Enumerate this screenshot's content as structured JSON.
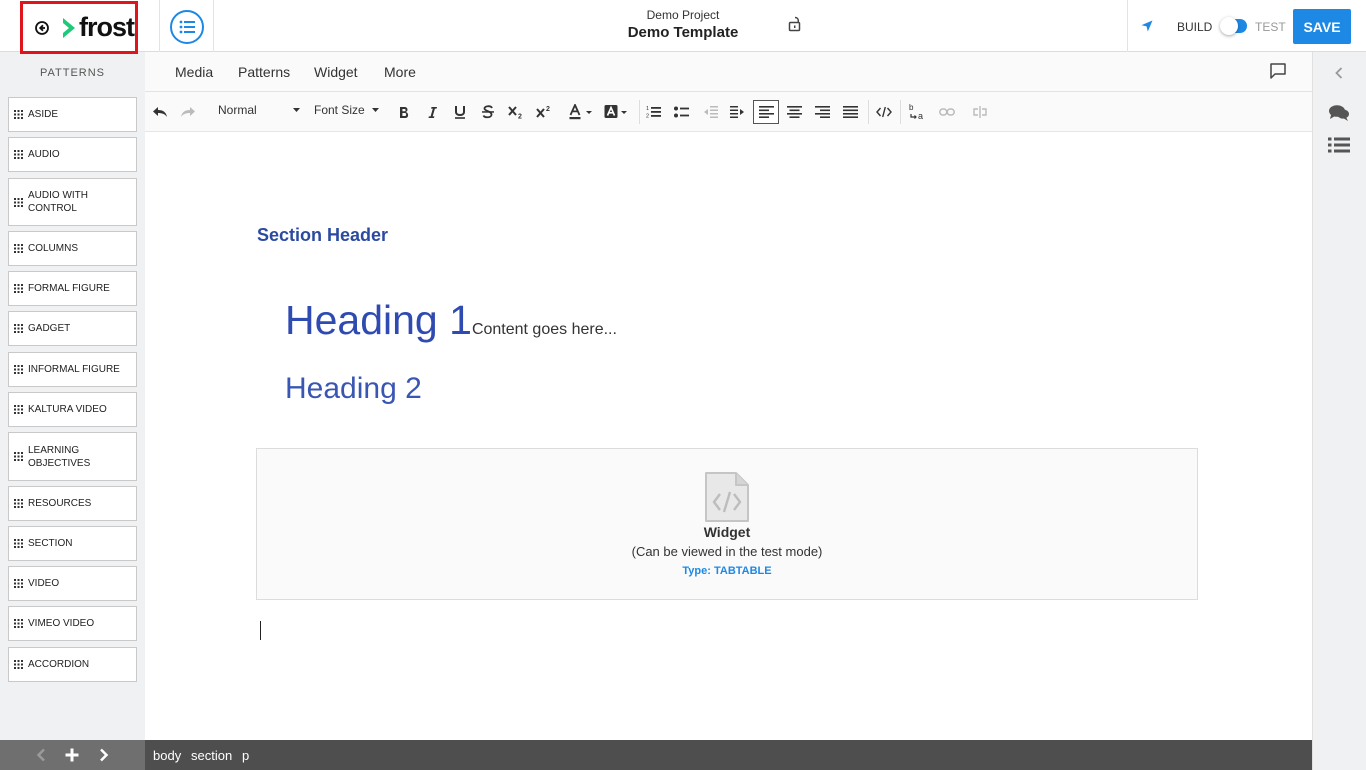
{
  "header": {
    "project_name": "Demo Project",
    "template_name": "Demo Template",
    "brand": "frost",
    "build_label": "BUILD",
    "test_label": "TEST",
    "save_label": "SAVE",
    "accent_color": "#1e88e5",
    "highlight_color": "#e0151b"
  },
  "sidebar": {
    "title": "PATTERNS",
    "items": [
      {
        "label": "ASIDE"
      },
      {
        "label": "AUDIO"
      },
      {
        "label": "AUDIO WITH CONTROL"
      },
      {
        "label": "COLUMNS"
      },
      {
        "label": "FORMAL FIGURE"
      },
      {
        "label": "GADGET"
      },
      {
        "label": "INFORMAL FIGURE"
      },
      {
        "label": "KALTURA VIDEO"
      },
      {
        "label": "LEARNING OBJECTIVES"
      },
      {
        "label": "RESOURCES"
      },
      {
        "label": "SECTION"
      },
      {
        "label": "VIDEO"
      },
      {
        "label": "VIMEO VIDEO"
      },
      {
        "label": "ACCORDION"
      }
    ]
  },
  "menu": {
    "media": "Media",
    "patterns": "Patterns",
    "widget": "Widget",
    "more": "More"
  },
  "toolbar": {
    "block_format": "Normal",
    "font_size": "Font Size"
  },
  "content": {
    "section_header": "Section Header",
    "heading1": "Heading 1",
    "heading1_content": "Content goes here...",
    "heading2": "Heading 2",
    "widget": {
      "title": "Widget",
      "note": "(Can be viewed in the test mode)",
      "type": "Type: TABTABLE"
    }
  },
  "statusbar": {
    "path": [
      "body",
      "section",
      "p"
    ]
  }
}
